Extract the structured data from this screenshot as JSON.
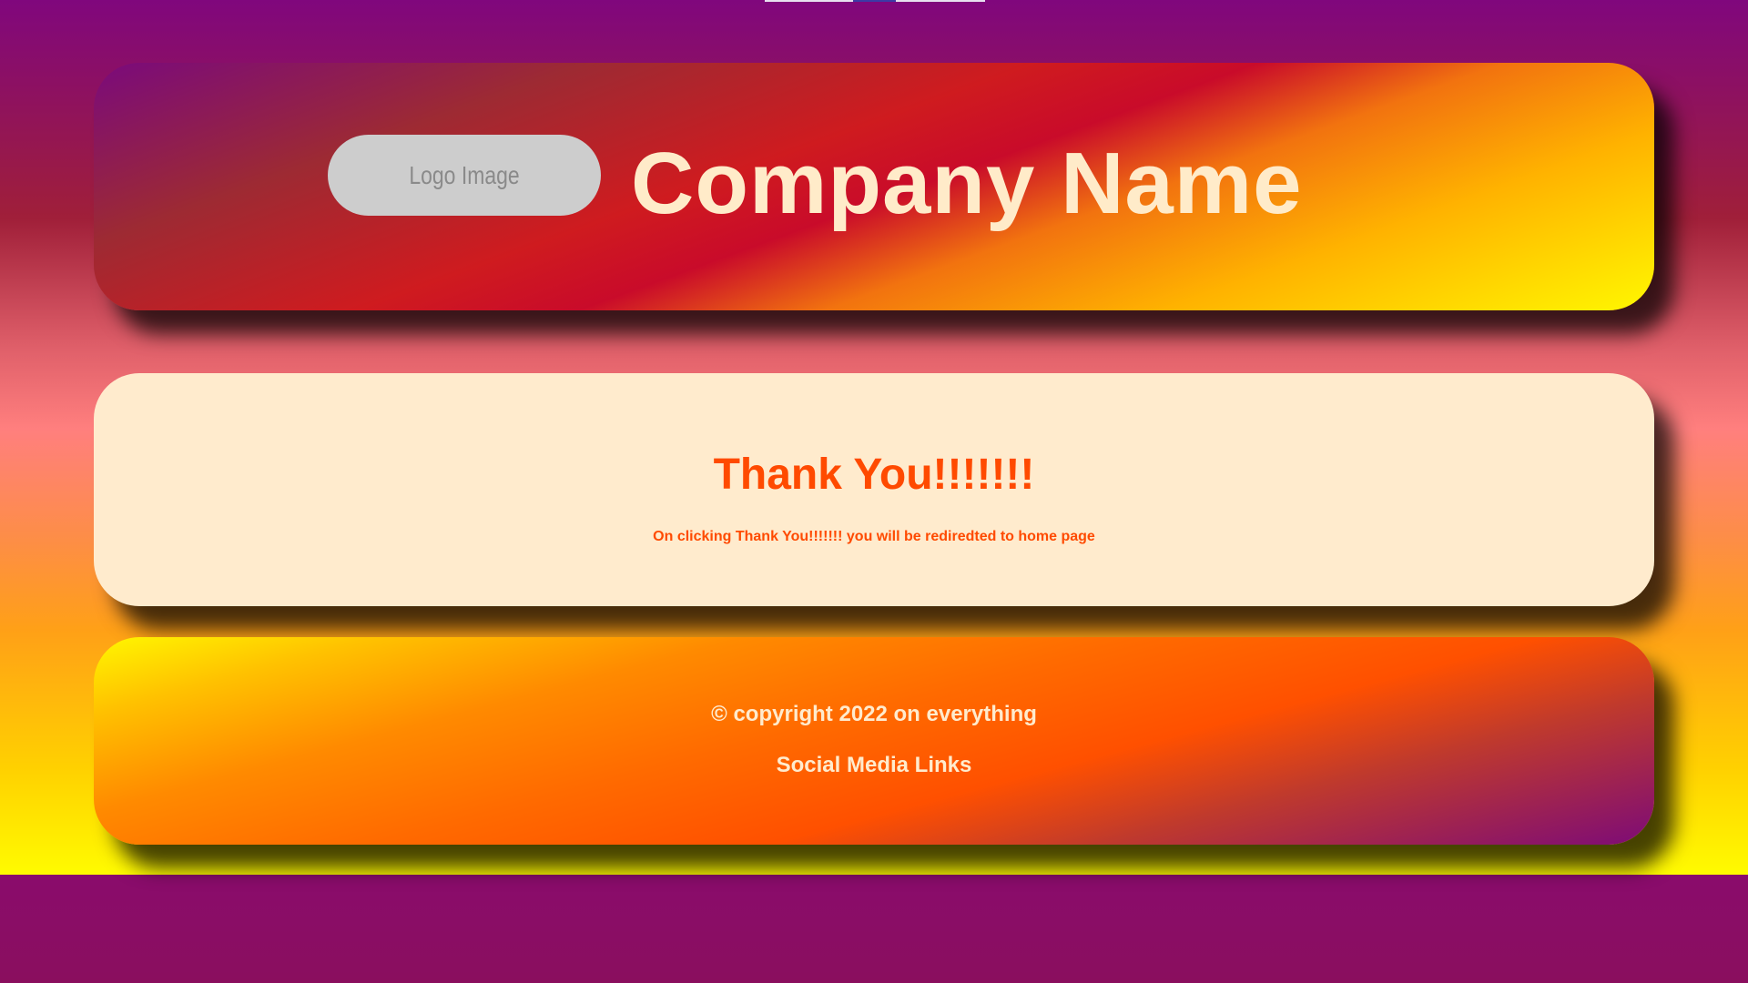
{
  "header": {
    "logo_label": "Logo Image",
    "company_name": "Company Name"
  },
  "main": {
    "title": "Thank You!!!!!!!",
    "note": "On clicking Thank You!!!!!!! you will be rediredted to home page"
  },
  "footer": {
    "copyright": "© copyright 2022 on everything",
    "social_label": "Social Media Links"
  },
  "colors": {
    "page_background": "#82067a",
    "card_text_light": "#ffebcd",
    "accent_orange": "#ff4a00",
    "main_card_background": "#ffebcd",
    "logo_placeholder": "#cdcdcd"
  }
}
